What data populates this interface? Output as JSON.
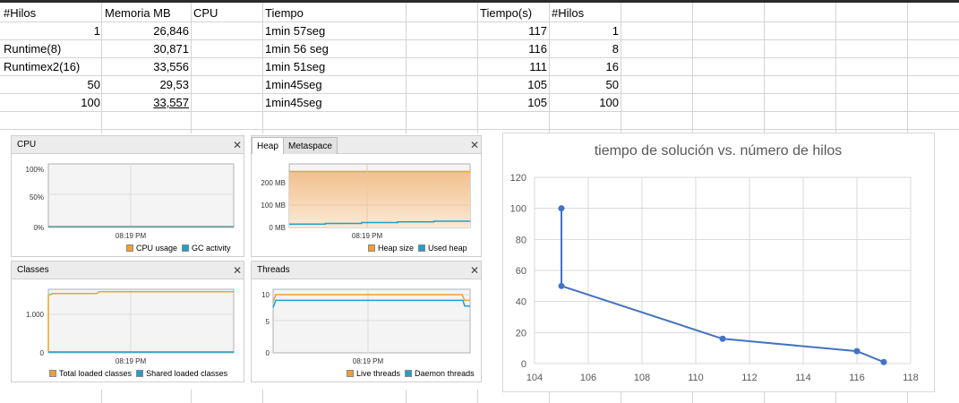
{
  "spreadsheet": {
    "headers": [
      "#Hilos",
      "Memoria MB",
      "CPU",
      "Tiempo",
      "Tiempo(s)",
      "#Hilos"
    ],
    "rows": [
      {
        "hilos": "1",
        "memoria": "26,846",
        "tiempo": "1min 57seg",
        "tiempo_s": "117",
        "hilos2": "1"
      },
      {
        "hilos": "Runtime(8)",
        "memoria": "30,871",
        "tiempo": "1min 56 seg",
        "tiempo_s": "116",
        "hilos2": "8"
      },
      {
        "hilos": "Runtimex2(16)",
        "memoria": "33,556",
        "tiempo": "1min 51seg",
        "tiempo_s": "111",
        "hilos2": "16"
      },
      {
        "hilos": "50",
        "memoria": "29,53",
        "tiempo": "1min45seg",
        "tiempo_s": "105",
        "hilos2": "50"
      },
      {
        "hilos": "100",
        "memoria": "33,557",
        "tiempo": "1min45seg",
        "tiempo_s": "105",
        "hilos2": "100"
      }
    ]
  },
  "monitor": {
    "cpu": {
      "title": "CPU",
      "close": "✕",
      "ticks": [
        "100%",
        "50%",
        "0%"
      ],
      "time": "08:19 PM",
      "legend": [
        "CPU usage",
        "GC activity"
      ],
      "usage_percent": 0,
      "gc_percent": 0
    },
    "heap": {
      "tab_active": "Heap",
      "tab_inactive": "Metaspace",
      "close": "✕",
      "ticks": [
        "200 MB",
        "100 MB",
        "0 MB"
      ],
      "time": "08:19 PM",
      "legend": [
        "Heap size",
        "Used heap"
      ],
      "heap_size_mb": 250,
      "used_heap_mb": [
        15,
        18,
        22,
        25,
        28
      ]
    },
    "classes": {
      "title": "Classes",
      "close": "✕",
      "ticks": [
        "1.000",
        "0"
      ],
      "time": "08:19 PM",
      "legend": [
        "Total loaded classes",
        "Shared loaded classes"
      ],
      "total_loaded": 1600,
      "shared_loaded": 0
    },
    "threads": {
      "title": "Threads",
      "close": "✕",
      "ticks": [
        "10",
        "5",
        "0"
      ],
      "time": "08:19 PM",
      "legend": [
        "Live threads",
        "Daemon threads"
      ],
      "live": [
        10,
        10,
        9
      ],
      "daemon": [
        9,
        9,
        8
      ]
    }
  },
  "colors": {
    "orange": "#f0a030",
    "blue": "#1ea0c8",
    "line_blue": "#4472c4"
  },
  "chart_data": {
    "type": "scatter",
    "title": "tiempo de solución vs. número de hilos",
    "series": [
      {
        "x": [
          117,
          116,
          111,
          105,
          105
        ],
        "y": [
          1,
          8,
          16,
          50,
          100
        ]
      }
    ],
    "xlim": [
      104,
      118
    ],
    "ylim": [
      0,
      120
    ],
    "x_ticks": [
      "104",
      "106",
      "108",
      "110",
      "112",
      "114",
      "116",
      "118"
    ],
    "y_ticks": [
      "0",
      "20",
      "40",
      "60",
      "80",
      "100",
      "120"
    ],
    "grid": true,
    "legend": "none"
  }
}
